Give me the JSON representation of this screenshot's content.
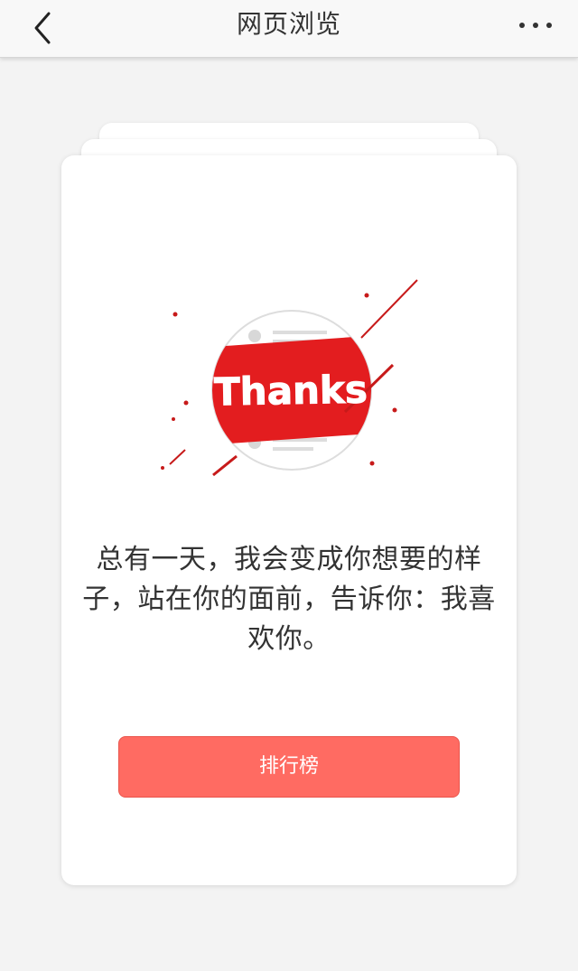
{
  "header": {
    "title": "网页浏览",
    "back_icon": "chevron-left-icon",
    "more_icon": "more-dots-icon"
  },
  "illustration": {
    "badge_text": "Thanks",
    "accent_color": "#e31d1f"
  },
  "card": {
    "message": "总有一天，我会变成你想要的样子，站在你的面前，告诉你：我喜欢你。",
    "button_label": "排行榜"
  },
  "colors": {
    "button": "#ff6b62",
    "accent": "#e31d1f"
  }
}
